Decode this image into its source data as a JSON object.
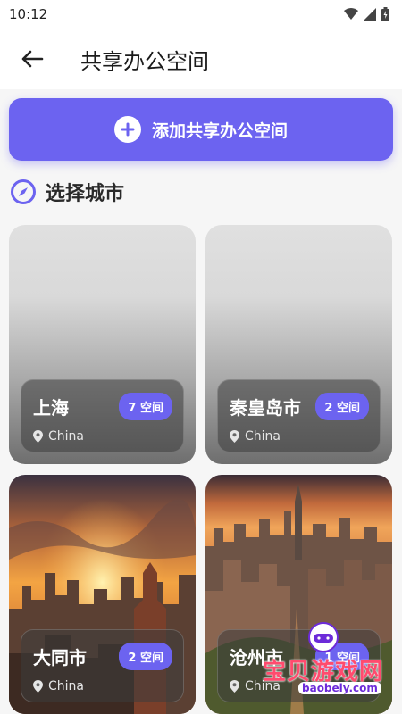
{
  "status_bar": {
    "time": "10:12"
  },
  "app_bar": {
    "title": "共享办公空间",
    "back_icon": "arrow-left-icon"
  },
  "add_button": {
    "label": "添加共享办公空间",
    "icon": "plus-circle-icon",
    "color": "#6c63f0"
  },
  "section": {
    "title": "选择城市",
    "icon": "compass-icon"
  },
  "cities": [
    {
      "name": "上海",
      "badge": "7 空间",
      "country": "China"
    },
    {
      "name": "秦皇岛市",
      "badge": "2 空间",
      "country": "China"
    },
    {
      "name": "大同市",
      "badge": "2 空间",
      "country": "China"
    },
    {
      "name": "沧州市",
      "badge": "1 空间",
      "country": "China"
    }
  ],
  "watermark": {
    "text": "宝贝游戏网",
    "url": "baobeiy.com"
  }
}
